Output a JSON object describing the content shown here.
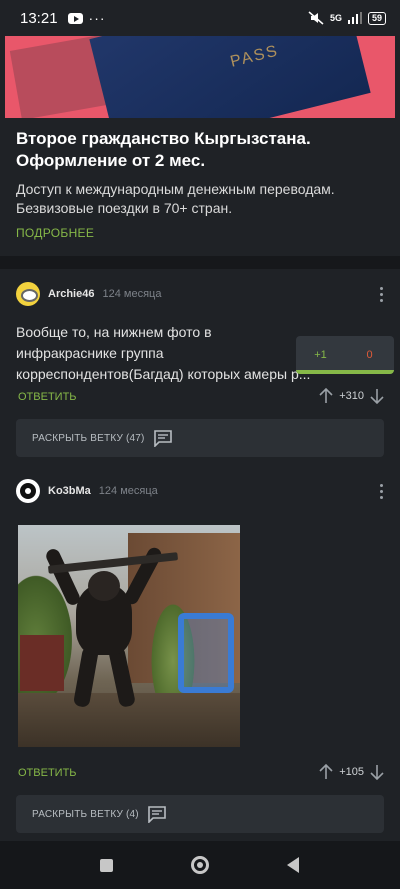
{
  "status_bar": {
    "time": "13:21",
    "network": "5G",
    "battery": "59",
    "icons": [
      "youtube-icon",
      "more-dots-icon",
      "mute-icon",
      "signal-icon",
      "battery-icon"
    ]
  },
  "ad": {
    "title": "Второе гражданство Кыргызстана. Оформление от 2 мес.",
    "description": "Доступ к международным денежным переводам. Безвизовые поездки в 70+ стран.",
    "more_label": "ПОДРОБНЕЕ",
    "passport_text": "PASS"
  },
  "comments": [
    {
      "author": "Archie46",
      "time": "124 месяца",
      "text": "Вообще то, на нижнем фото в инфракраснике группа корреспондентов(Багдад) которых амеры р... вертолета, а потом сука ху... признались пид...",
      "reply_label": "ОТВЕТИТЬ",
      "rating": "+310",
      "expand_label": "РАСКРЫТЬ ВЕТКУ (47)"
    },
    {
      "author": "Ko3bMa",
      "time": "124 месяца",
      "reply_label": "ОТВЕТИТЬ",
      "rating": "+105",
      "expand_label": "РАСКРЫТЬ ВЕТКУ (4)"
    }
  ],
  "vote_popup": {
    "plus": "+1",
    "minus": "0"
  },
  "colors": {
    "accent_green": "#86b848",
    "minus_red": "#e05a38",
    "background": "#1f2226"
  }
}
